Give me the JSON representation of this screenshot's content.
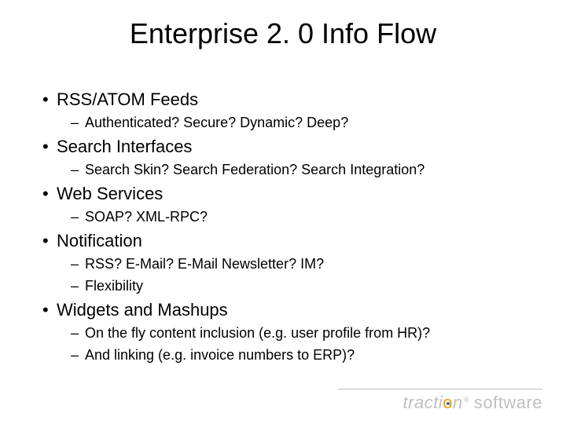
{
  "title": "Enterprise 2. 0 Info Flow",
  "bullets": [
    {
      "text": "RSS/ATOM Feeds",
      "sub": [
        "Authenticated? Secure? Dynamic? Deep?"
      ]
    },
    {
      "text": "Search Interfaces",
      "sub": [
        "Search Skin? Search Federation? Search Integration?"
      ]
    },
    {
      "text": "Web Services",
      "sub": [
        "SOAP? XML-RPC?"
      ]
    },
    {
      "text": "Notification",
      "sub": [
        "RSS? E-Mail? E-Mail Newsletter? IM?",
        "Flexibility"
      ]
    },
    {
      "text": "Widgets and Mashups",
      "sub": [
        "On the fly content inclusion (e.g. user profile from HR)?",
        "And linking (e.g. invoice numbers to ERP)?"
      ]
    }
  ],
  "footer": {
    "brand_left": "tracti",
    "brand_o": "o",
    "brand_right": "n",
    "reg": "®",
    "brand_suffix": "software"
  }
}
